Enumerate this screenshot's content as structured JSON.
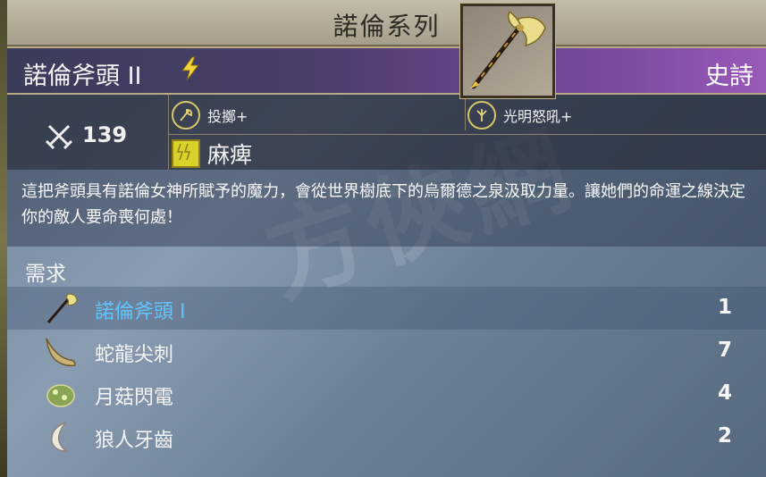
{
  "header": {
    "title": "諾倫系列"
  },
  "item": {
    "name": "諾倫斧頭 II",
    "rarity": "史詩",
    "icon": "axe-icon",
    "element_icon": "lightning-icon"
  },
  "stats": {
    "attack_icon": "crossed-swords-icon",
    "attack": "139",
    "skills": [
      {
        "icon": "throw-axe-icon",
        "label": "投擲+"
      },
      {
        "icon": "radiant-tree-icon",
        "label": "光明怒吼+"
      }
    ],
    "effect": {
      "icon": "paralysis-icon",
      "label": "麻痺"
    }
  },
  "description": "這把斧頭具有諾倫女神所賦予的魔力，會從世界樹底下的烏爾德之泉汲取力量。讓她們的命運之線決定你的敵人要命喪何處！",
  "requirements": {
    "title": "需求",
    "items": [
      {
        "icon": "axe-icon",
        "name": "諾倫斧頭 I",
        "count": "1",
        "link": true
      },
      {
        "icon": "dragon-spike-icon",
        "name": "蛇龍尖刺",
        "count": "7",
        "link": false
      },
      {
        "icon": "moon-mushroom-icon",
        "name": "月菇閃電",
        "count": "4",
        "link": false
      },
      {
        "icon": "wolf-fang-icon",
        "name": "狼人牙齒",
        "count": "2",
        "link": false
      }
    ]
  },
  "colors": {
    "accent_link": "#5ec4ff",
    "rarity_purple": "#9a5ab8",
    "effect_yellow": "#d8d22a"
  }
}
